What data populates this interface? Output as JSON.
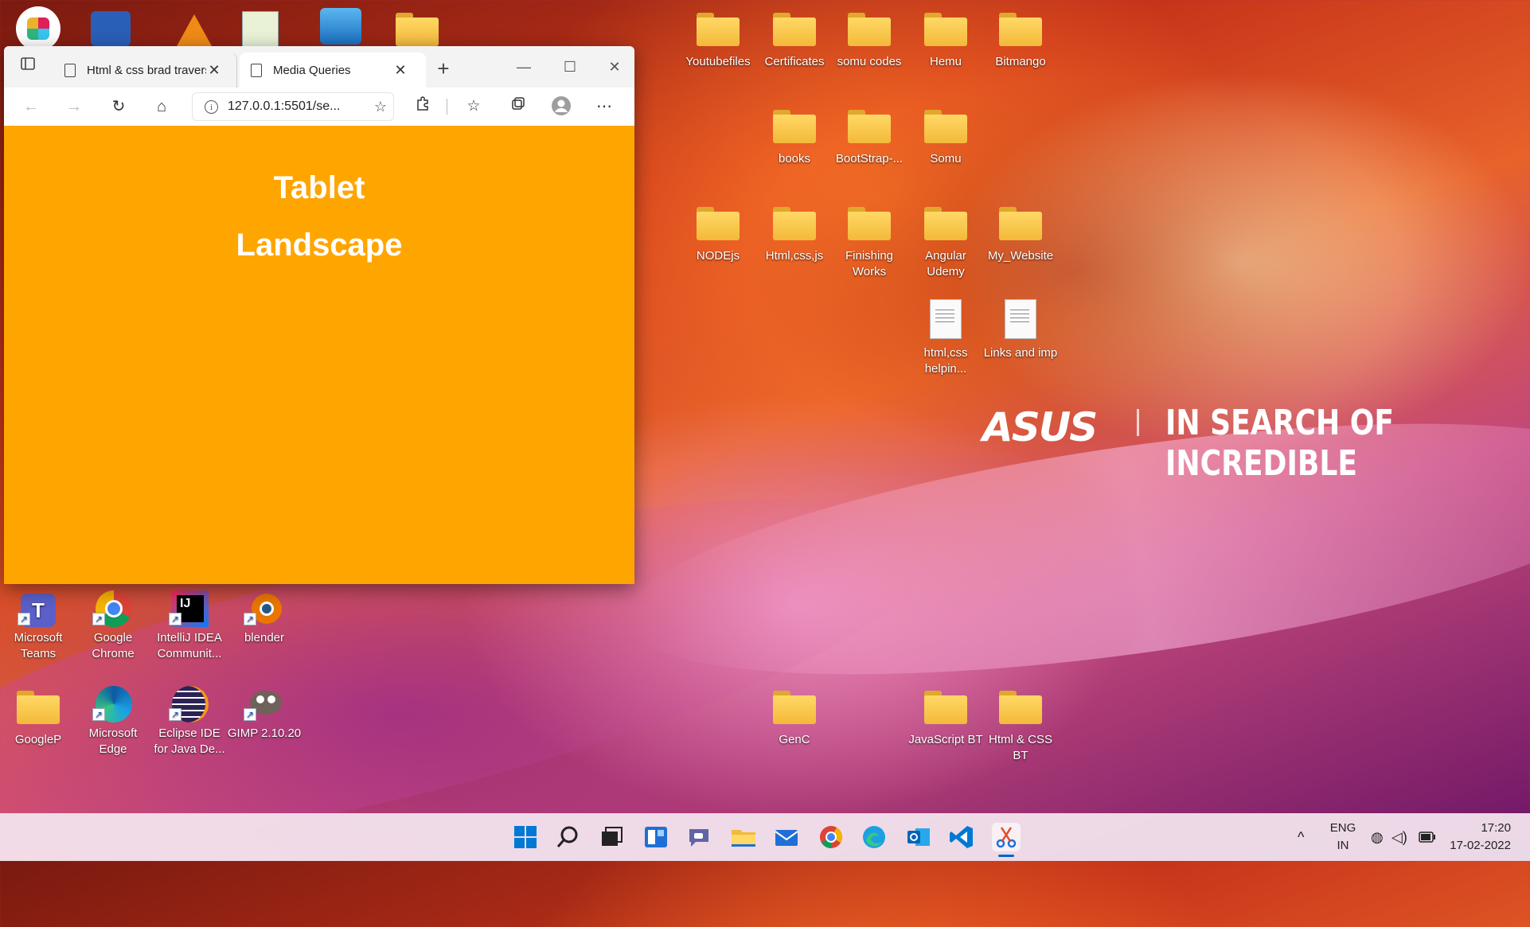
{
  "desktop": {
    "top_icons": [
      {
        "name": "Youtubefiles"
      },
      {
        "name": "Certificates"
      },
      {
        "name": "somu codes"
      },
      {
        "name": "Hemu"
      },
      {
        "name": "Bitmango"
      },
      {
        "name": "books"
      },
      {
        "name": "BootStrap-..."
      },
      {
        "name": "Somu"
      },
      {
        "name": "NODEjs"
      },
      {
        "name": "Html,css,js"
      },
      {
        "name": "Finishing Works"
      },
      {
        "name": "Angular Udemy"
      },
      {
        "name": "My_Website"
      },
      {
        "name": "html,css helpin..."
      },
      {
        "name": "Links and imp"
      }
    ],
    "left_icons": [
      {
        "name": "Microsoft Teams"
      },
      {
        "name": "Google Chrome"
      },
      {
        "name": "IntelliJ IDEA Communit..."
      },
      {
        "name": "blender"
      },
      {
        "name": "GoogleP"
      },
      {
        "name": "Microsoft Edge"
      },
      {
        "name": "Eclipse IDE for Java De..."
      },
      {
        "name": "GIMP 2.10.20"
      }
    ],
    "bottom_icons": [
      {
        "name": "GenC"
      },
      {
        "name": "JavaScript BT"
      },
      {
        "name": "Html & CSS BT"
      }
    ],
    "wallpaper": {
      "brand": "ASUS",
      "tagline": "IN SEARCH OF INCREDIBLE"
    }
  },
  "browser": {
    "tabs": [
      {
        "label": "Html & css brad traversy"
      },
      {
        "label": "Media Queries"
      }
    ],
    "address": "127.0.0.1:5501/se...",
    "content": {
      "line1": "Tablet",
      "line2": "Landscape",
      "background": "#ffa500"
    }
  },
  "taskbar": {
    "language": "ENG",
    "region": "IN",
    "time": "17:20",
    "date": "17-02-2022"
  }
}
